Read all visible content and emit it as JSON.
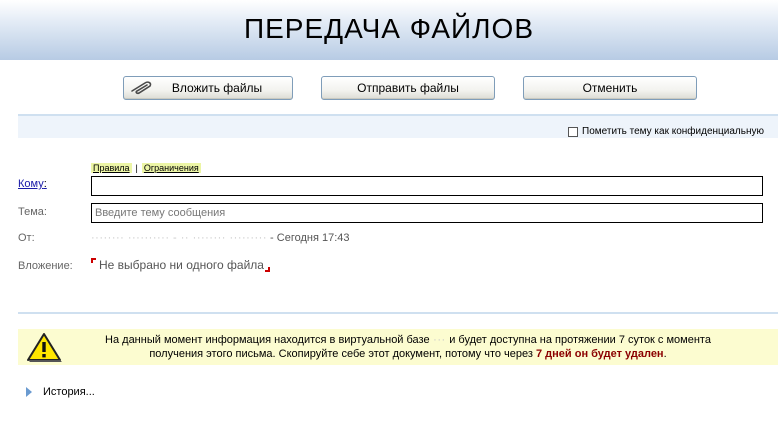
{
  "header": {
    "title": "ПЕРЕДАЧА ФАЙЛОВ"
  },
  "toolbar": {
    "attach_label": "Вложить файлы",
    "send_label": "Отправить файлы",
    "cancel_label": "Отменить"
  },
  "options": {
    "confidential_label": "Пометить тему как конфиденциальную",
    "confidential_checked": false
  },
  "links": {
    "rules": "Правила",
    "separator": "|",
    "limits": "Ограничения"
  },
  "form": {
    "to_label": "Кому",
    "to_colon": ":",
    "to_value": "",
    "subject_label": "Тема:",
    "subject_placeholder": "Введите тему сообщения",
    "from_label": "От:",
    "from_value_blurred": "········ ·········· - ·· ········ ·········",
    "from_separator": " - ",
    "from_time": "Сегодня 17:43",
    "attach_label": "Вложение:",
    "attach_value": "Не выбрано ни одного файла"
  },
  "notice": {
    "text_part1": "На данный момент информация находится в виртуальной базе",
    "text_blurred": " ··· ",
    "text_part2": "и будет доступна на протяжении 7 суток с момента получения этого письма. Скопируйте себе этот документ, потому что через",
    "text_red": "7 дней он будет удален",
    "text_end": "."
  },
  "history": {
    "label": "История..."
  },
  "colors": {
    "header_gradient_end": "#b7cbe4",
    "notice_bg": "#fcfcd0",
    "warning_red": "#8b0000",
    "link_highlight": "#ecf5a5"
  }
}
